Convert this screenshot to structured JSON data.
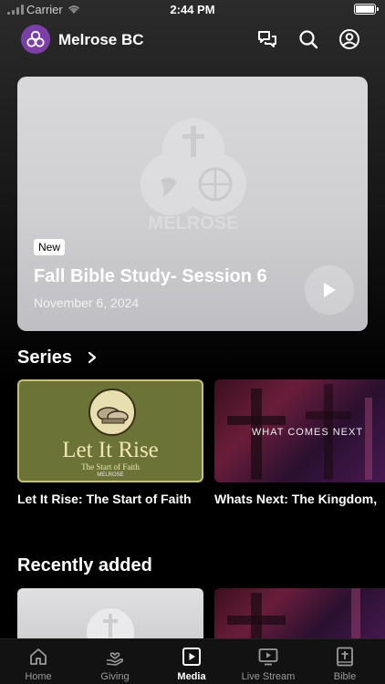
{
  "status_bar": {
    "carrier": "Carrier",
    "time": "2:44 PM"
  },
  "header": {
    "org_name": "Melrose BC"
  },
  "featured": {
    "badge": "New",
    "title": "Fall Bible Study- Session 6",
    "date": "November 6, 2024",
    "watermark_text": "MELROSE"
  },
  "series": {
    "title": "Series",
    "items": [
      {
        "caption": "Let It Rise: The Start of Faith",
        "art_title": "Let It Rise",
        "art_subtitle": "The Start of Faith",
        "art_brand": "MELROSE"
      },
      {
        "caption": "Whats Next: The Kingdom,",
        "art_title": "WHAT COMES NEXT"
      }
    ]
  },
  "recent": {
    "title": "Recently added"
  },
  "tabs": [
    {
      "label": "Home",
      "icon": "home-icon",
      "active": false
    },
    {
      "label": "Giving",
      "icon": "giving-icon",
      "active": false
    },
    {
      "label": "Media",
      "icon": "media-icon",
      "active": true
    },
    {
      "label": "Live Stream",
      "icon": "live-stream-icon",
      "active": false
    },
    {
      "label": "Bible",
      "icon": "bible-icon",
      "active": false
    }
  ],
  "colors": {
    "brand": "#7b3fa7",
    "background": "#000000",
    "tab_active": "#ffffff",
    "tab_inactive": "#9a9a9a"
  }
}
